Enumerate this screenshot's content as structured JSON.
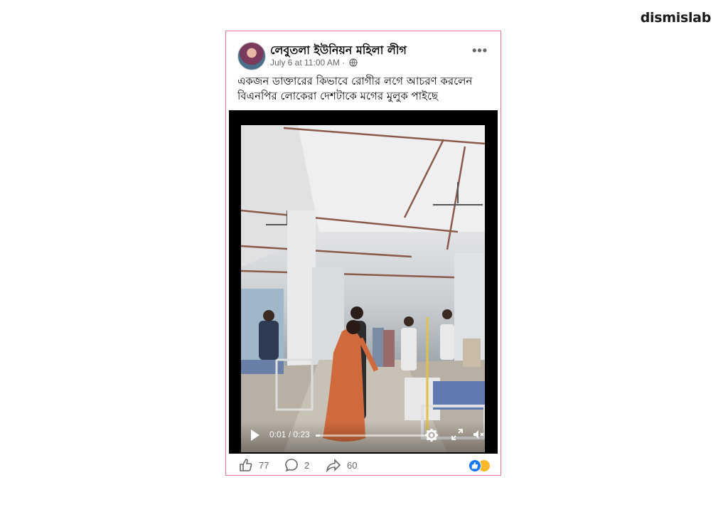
{
  "brand": {
    "label": "dismislab"
  },
  "post": {
    "author": "লেবুতলা ইউনিয়ন মহিলা লীগ",
    "time": "July 6 at 11:00 AM ·",
    "more_icon": "more-options-icon",
    "text_line1": "একজন ডাক্তারের কিভাবে রোগীর লগে আচরণ করলেন",
    "text_line2": "বিএনপির লোকেরা দেশটাকে মগের মুলুক পাইছে",
    "video": {
      "time_display": "0:01 / 0:23",
      "progress": 0.04,
      "icons": [
        "play-icon",
        "settings-icon",
        "fullscreen-icon",
        "mute-icon"
      ]
    },
    "reactions": {
      "likes": "77",
      "comments": "2",
      "shares": "60"
    },
    "colors": {
      "card_border": "#e07a8e",
      "like_blue": "#1877f2",
      "emoji_yellow": "#f7b928"
    }
  }
}
